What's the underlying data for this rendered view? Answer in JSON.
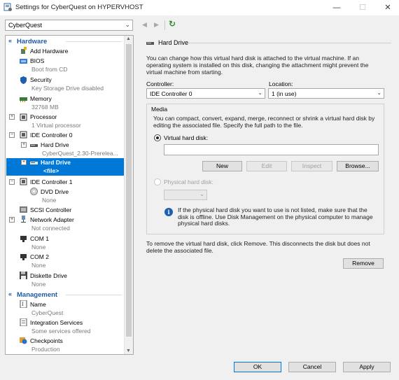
{
  "window": {
    "title": "Settings for CyberQuest on HYPERVHOST",
    "minimize": "—",
    "maximize": "☐",
    "close": "✕"
  },
  "vm_selector": {
    "value": "CyberQuest"
  },
  "nav": {
    "back": "◀",
    "forward": "▶",
    "refresh": "↻"
  },
  "tree": {
    "hardware_header": "Hardware",
    "management_header": "Management",
    "items": {
      "add_hardware": {
        "name": "Add Hardware"
      },
      "bios": {
        "name": "BIOS",
        "sub": "Boot from CD"
      },
      "security": {
        "name": "Security",
        "sub": "Key Storage Drive disabled"
      },
      "memory": {
        "name": "Memory",
        "sub": "32768 MB"
      },
      "processor": {
        "name": "Processor",
        "sub": "1 Virtual processor"
      },
      "ide0": {
        "name": "IDE Controller 0"
      },
      "ide0_hd": {
        "name": "Hard Drive",
        "sub": "CyberQuest_2.30-Prerelea..."
      },
      "ide0_hd2": {
        "name": "Hard Drive",
        "sub": "<file>"
      },
      "ide1": {
        "name": "IDE Controller 1"
      },
      "dvd": {
        "name": "DVD Drive",
        "sub": "None"
      },
      "scsi": {
        "name": "SCSI Controller"
      },
      "network": {
        "name": "Network Adapter",
        "sub": "Not connected"
      },
      "com1": {
        "name": "COM 1",
        "sub": "None"
      },
      "com2": {
        "name": "COM 2",
        "sub": "None"
      },
      "diskette": {
        "name": "Diskette Drive",
        "sub": "None"
      },
      "name": {
        "name": "Name",
        "sub": "CyberQuest"
      },
      "integration": {
        "name": "Integration Services",
        "sub": "Some services offered"
      },
      "checkpoints": {
        "name": "Checkpoints",
        "sub": "Production"
      }
    }
  },
  "panel": {
    "group_title": "Hard Drive",
    "description": "You can change how this virtual hard disk is attached to the virtual machine. If an operating system is installed on this disk, changing the attachment might prevent the virtual machine from starting.",
    "controller_label": "Controller:",
    "controller_value": "IDE Controller 0",
    "location_label": "Location:",
    "location_value": "1 (in use)",
    "media_title": "Media",
    "media_description": "You can compact, convert, expand, merge, reconnect or shrink a virtual hard disk by editing the associated file. Specify the full path to the file.",
    "vhd_label": "Virtual hard disk:",
    "vhd_path": "",
    "buttons": {
      "new": "New",
      "edit": "Edit",
      "inspect": "Inspect",
      "browse": "Browse..."
    },
    "physical_label": "Physical hard disk:",
    "physical_value": "",
    "info_text": "If the physical hard disk you want to use is not listed, make sure that the disk is offline. Use Disk Management on the physical computer to manage physical hard disks.",
    "remove_description": "To remove the virtual hard disk, click Remove. This disconnects the disk but does not delete the associated file.",
    "remove_button": "Remove"
  },
  "footer": {
    "ok": "OK",
    "cancel": "Cancel",
    "apply": "Apply"
  }
}
